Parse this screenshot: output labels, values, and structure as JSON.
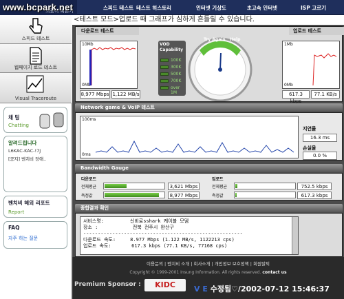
{
  "watermark": "www.bcpark.net",
  "brand": {
    "sub": "최종이 빠른가"
  },
  "nav": {
    "items": [
      "스피드 테스트",
      "테스트 히스토리",
      "인터넷 기상도",
      "초고속 인터넷",
      "ISP 고르기"
    ]
  },
  "sidebar": {
    "items": [
      "스피드 테스트",
      "웹페이지 로드 테스트",
      "Visual Traceroute"
    ],
    "chat": {
      "title": "채 팅",
      "sub": "Chatting"
    },
    "notice": {
      "title": "알려드립니다",
      "line1": "L6KAC-KAC-!7J",
      "line2": "[공지] 벤치비 장애.."
    },
    "report": {
      "title": "벤치비 해외 리포트",
      "sub": "Report"
    },
    "faq": {
      "title": "FAQ",
      "sub": "자주 하는 질문"
    }
  },
  "header": {
    "text": "<테스트 모드>업로드 때 그래프가 심하게 흔들릴 수 있습니다."
  },
  "download": {
    "title": "다운로드 테스트",
    "top": "10Mb",
    "bottom": "0Mb",
    "speed": "8,977 Mbps",
    "bytes": "1,122 MB/s"
  },
  "upload": {
    "title": "업로드 테스트",
    "top": "1Mb",
    "bottom": "0Mb",
    "speed": "617.3 kbps",
    "bytes": "77.1 KB/s"
  },
  "vod": {
    "title": "VOD Capability",
    "levels": [
      "100K",
      "300K",
      "500K",
      "700K",
      "over 1M"
    ],
    "lit": 5
  },
  "gauge": {
    "try_again": "Try Again",
    "help": "Help",
    "value_fraction": 0.5
  },
  "game": {
    "title": "Network game & VoIP 테스트",
    "top": "100ms",
    "bottom": "0ms",
    "latency_label": "지연율",
    "latency": "16.3 ms",
    "loss_label": "손실율",
    "loss": "0.0 %"
  },
  "bw": {
    "title": "Bandwidth Gauge",
    "down_title": "다운로드",
    "up_title": "업로드",
    "avg_label": "전체평균",
    "cur_label": "측정값",
    "down_avg": "3,621 Mbps",
    "down_cur": "8,977 Mbps",
    "up_avg": "752.5 kbps",
    "up_cur": "617.3 kbps",
    "down_avg_fill": 0.36,
    "down_cur_fill": 0.9,
    "up_avg_fill": 0.03,
    "up_cur_fill": 0.02
  },
  "result": {
    "title": "종합결과 확인",
    "lines": [
      "서비스명:         신비로sshark 케이블 모뎀",
      "장소 :            전북 전주시 완산구",
      "-------------------------------------------------------",
      "다운로드 속도:     8.977 Mbps (1.122 MB/s, 1122213 cps)",
      "업로드 속도:       617.3 kbps (77.1 KB/s, 77168 cps)"
    ]
  },
  "footer": {
    "links": "이용문의 | 벤치비 소개 | 회사소개 | 개인정보 보호정책 | 회원탈퇴",
    "copyright": "Copyright © 1999-2001 Insung Information. All rights reserved.",
    "contact": "contact us",
    "premium": "Premium Sponsor :",
    "sponsor": "KIDC"
  },
  "stamp": {
    "ve": "V E",
    "text": "수정됨♡/2002-07-12 15:46:37"
  },
  "colors": {
    "nav": "#1f2f5c",
    "green": "#5fbf3a",
    "dark": "#4a4a4a"
  }
}
